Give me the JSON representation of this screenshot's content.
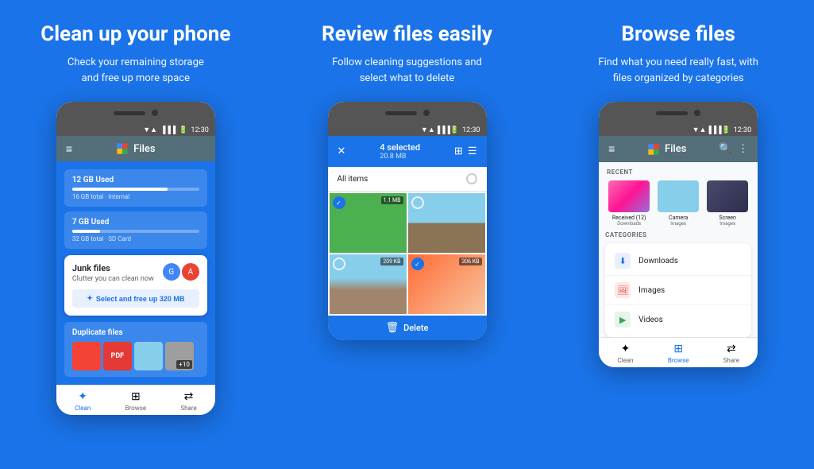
{
  "panel1": {
    "title": "Clean up your phone",
    "subtitle": "Check your remaining storage\nand free up more space",
    "storage1": {
      "label": "12 GB Used",
      "fill_percent": 75,
      "detail": "16 GB total · Internal"
    },
    "storage2": {
      "label": "7 GB Used",
      "fill_percent": 22,
      "detail": "32 GB total · SD Card"
    },
    "junk": {
      "title": "Junk files",
      "subtitle": "Clutter you can clean now",
      "button": "Select and free up 320 MB"
    },
    "duplicate": {
      "title": "Duplicate files",
      "count_badge": "+10"
    },
    "nav": {
      "clean_label": "Clean",
      "browse_label": "Browse",
      "share_label": "Share"
    },
    "status_time": "12:30"
  },
  "panel2": {
    "title": "Review files easily",
    "subtitle": "Follow cleaning suggestions and\nselect what to delete",
    "phone": {
      "selected_text": "4 selected",
      "selected_size": "20.8 MB",
      "all_items": "All items",
      "img1_size": "1.1 MB",
      "img2_size": "209 KB",
      "img3_size": "306 KB",
      "delete_label": "Delete"
    },
    "status_time": "12:30"
  },
  "panel3": {
    "title": "Browse files",
    "subtitle": "Find what you need really fast, with\nfiles organized by categories",
    "phone": {
      "navbar_title": "Files",
      "recent_label": "RECENT",
      "categories_label": "CATEGORIES",
      "recent_items": [
        {
          "name": "Received (12)",
          "sub": "Downloads"
        },
        {
          "name": "Camera",
          "sub": "Images"
        },
        {
          "name": "Screen",
          "sub": "Images"
        }
      ],
      "categories": [
        {
          "name": "Downloads",
          "color": "#1a73e8",
          "icon": "⬇"
        },
        {
          "name": "Images",
          "color": "#e53935",
          "icon": "🖼"
        },
        {
          "name": "Videos",
          "color": "#43a047",
          "icon": "▶"
        }
      ],
      "nav_active": "Browse"
    },
    "status_time": "12:30"
  }
}
